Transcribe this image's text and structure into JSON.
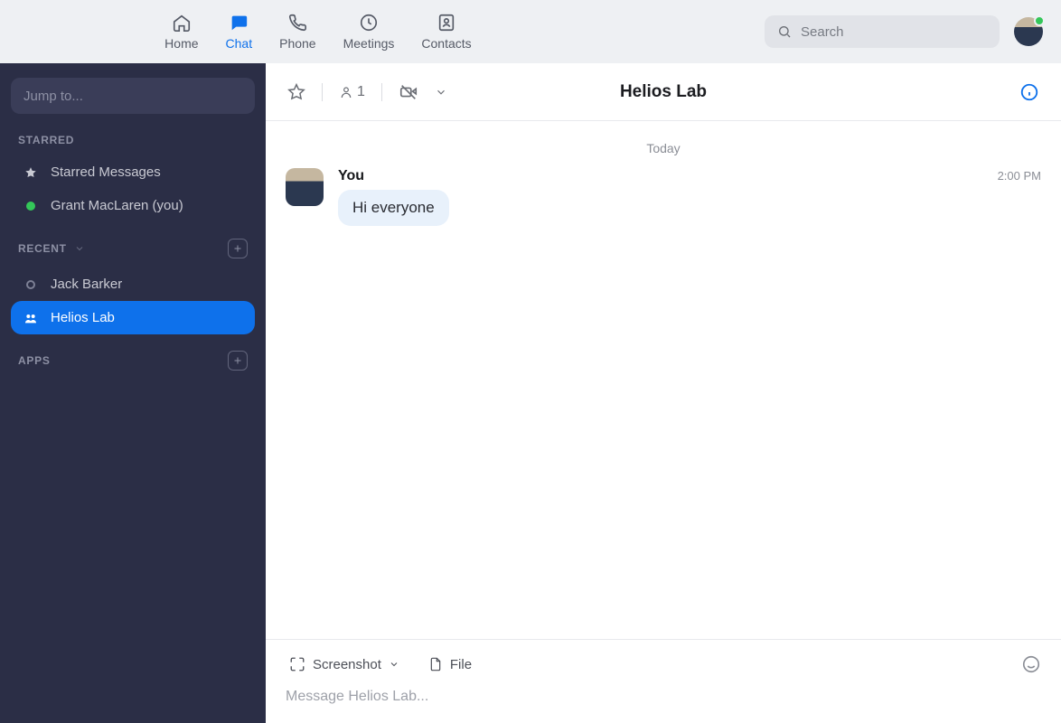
{
  "topnav": {
    "items": [
      {
        "label": "Home"
      },
      {
        "label": "Chat"
      },
      {
        "label": "Phone"
      },
      {
        "label": "Meetings"
      },
      {
        "label": "Contacts"
      }
    ],
    "active_index": 1
  },
  "search": {
    "placeholder": "Search"
  },
  "sidebar": {
    "jump_placeholder": "Jump to...",
    "sections": {
      "starred": {
        "label": "STARRED",
        "items": [
          {
            "label": "Starred Messages",
            "icon": "star",
            "status": null
          },
          {
            "label": "Grant MacLaren (you)",
            "icon": "status",
            "status": "online"
          }
        ]
      },
      "recent": {
        "label": "RECENT",
        "items": [
          {
            "label": "Jack Barker",
            "icon": "status",
            "status": "offline"
          },
          {
            "label": "Helios Lab",
            "icon": "group",
            "status": null,
            "active": true
          }
        ]
      },
      "apps": {
        "label": "APPS"
      }
    }
  },
  "chat": {
    "title": "Helios Lab",
    "member_count": "1",
    "date_label": "Today",
    "messages": [
      {
        "author": "You",
        "time": "2:00 PM",
        "text": "Hi everyone"
      }
    ],
    "composer": {
      "screenshot_label": "Screenshot",
      "file_label": "File",
      "placeholder": "Message Helios Lab..."
    }
  }
}
